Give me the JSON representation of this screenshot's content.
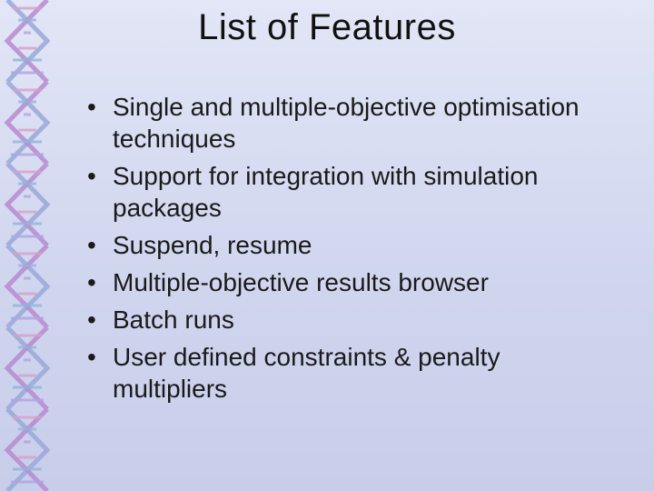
{
  "title": "List of Features",
  "bullets": [
    "Single and multiple-objective optimisation techniques",
    "Support for integration with simulation packages",
    "Suspend, resume",
    "Multiple-objective results browser",
    "Batch runs",
    "User defined constraints & penalty multipliers"
  ]
}
